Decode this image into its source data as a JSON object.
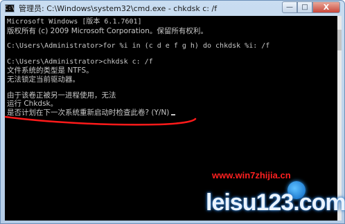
{
  "window": {
    "title": "管理员: C:\\Windows\\system32\\cmd.exe - chkdsk  c: /f",
    "icon_text": "C:\\",
    "controls": {
      "minimize": "—",
      "maximize": "□",
      "close": "X"
    }
  },
  "console": {
    "lines": [
      "Microsoft Windows [版本 6.1.7601]",
      "版权所有 (c) 2009 Microsoft Corporation。保留所有权利。",
      "",
      "C:\\Users\\Administrator>for %i in (c d e f g h) do chkdsk %i: /f",
      "",
      "C:\\Users\\Administrator>chkdsk c: /f",
      "文件系统的类型是 NTFS。",
      "无法锁定当前驱动器。",
      "",
      "由于该卷正被另一进程使用，无法",
      "运行 Chkdsk。",
      "是否计划在下一次系统重新启动时检查此卷? (Y/N)"
    ]
  },
  "watermarks": {
    "url": "www.win7zhijia.cn",
    "brand": "leisu123.com"
  },
  "colors": {
    "console_bg": "#000000",
    "console_text": "#c8c8c8",
    "annotation": "#ff1a1a",
    "watermark_url": "#ff2020"
  }
}
